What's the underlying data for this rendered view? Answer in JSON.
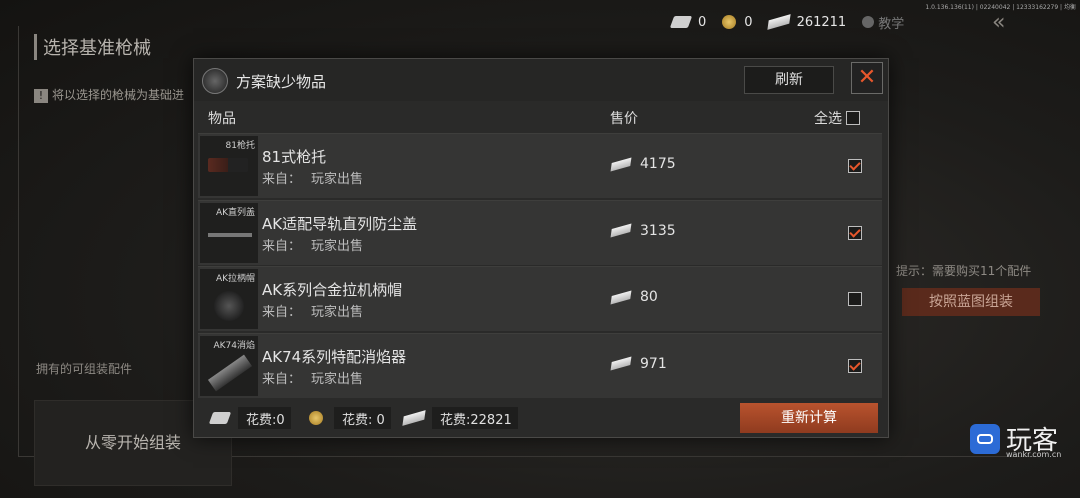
{
  "version": "1.0.136.136(11) | 02240042 | 12333162279 | 均衡",
  "background": {
    "title": "选择基准枪械",
    "note": "将以选择的枪械为基础进",
    "owned_label": "拥有的可组装配件",
    "start_button": "从零开始组装",
    "hint": "提示：需要购买11个配件",
    "assemble_button": "按照蓝图组装"
  },
  "currency": {
    "ticket": "0",
    "coin": "0",
    "cash": "261211",
    "tutorial_label": "教学"
  },
  "modal": {
    "title": "方案缺少物品",
    "refresh_label": "刷新",
    "close_icon": "✕",
    "columns": {
      "item": "物品",
      "price": "售价",
      "select_all": "全选"
    },
    "select_all_checked": false,
    "items": [
      {
        "thumb_label": "81枪托",
        "name": "81式枪托",
        "source_label": "来自：",
        "source": "玩家出售",
        "price": "4175",
        "checked": true,
        "icon": "stock"
      },
      {
        "thumb_label": "AK直列盖",
        "name": "AK适配导轨直列防尘盖",
        "source_label": "来自：",
        "source": "玩家出售",
        "price": "3135",
        "checked": true,
        "icon": "rail"
      },
      {
        "thumb_label": "AK拉柄帽",
        "name": "AK系列合金拉机柄帽",
        "source_label": "来自：",
        "source": "玩家出售",
        "price": "80",
        "checked": false,
        "icon": "cap"
      },
      {
        "thumb_label": "AK74消焰",
        "name": "AK74系列特配消焰器",
        "source_label": "来自：",
        "source": "玩家出售",
        "price": "971",
        "checked": true,
        "icon": "muzzle"
      }
    ],
    "footer": {
      "cost_ticket": "花费:0",
      "cost_coin": "花费: 0",
      "cost_cash": "花费:22821",
      "recalc_label": "重新计算"
    }
  },
  "watermark": {
    "brand": "玩客",
    "url": "wankr.com.cn"
  }
}
